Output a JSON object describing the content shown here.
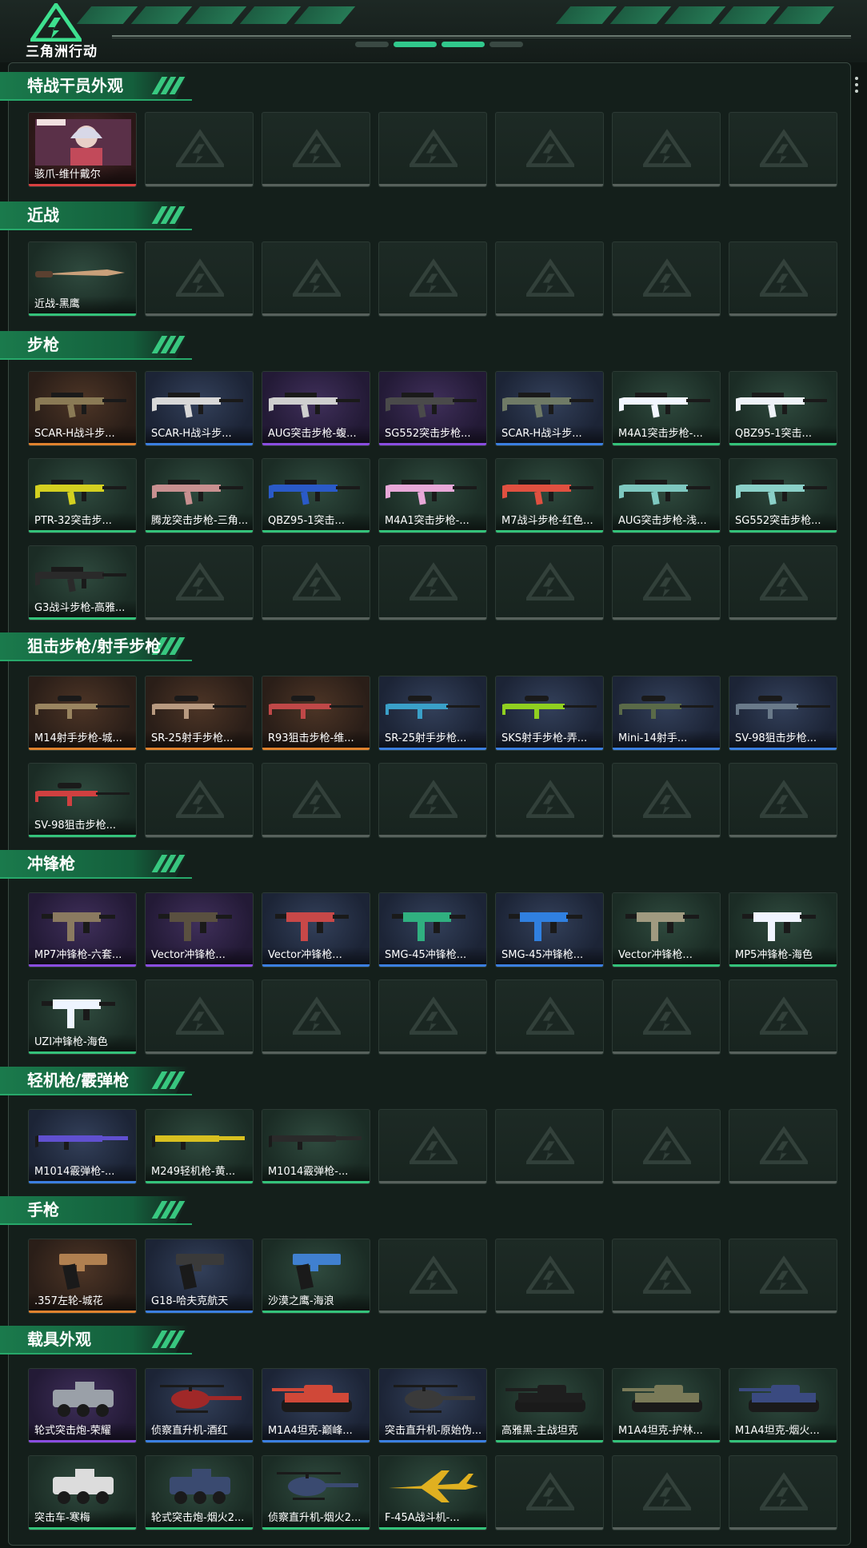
{
  "brand": "三角洲行动",
  "sections": [
    {
      "title": "特战干员外观",
      "items": [
        {
          "label": "骇爪-维什戴尔",
          "quality": "red",
          "icon": "operator-portrait-icon",
          "color": "#c24a5a"
        }
      ]
    },
    {
      "title": "近战",
      "items": [
        {
          "label": "近战-黑鹰",
          "quality": "green",
          "icon": "knife-icon",
          "color": "#c9a07a"
        }
      ]
    },
    {
      "title": "步枪",
      "items": [
        {
          "label": "SCAR-H战斗步...",
          "quality": "orange",
          "icon": "rifle-icon",
          "color": "#8a7a55"
        },
        {
          "label": "SCAR-H战斗步...",
          "quality": "blue",
          "icon": "rifle-icon",
          "color": "#d8d8d8"
        },
        {
          "label": "AUG突击步枪-蝮...",
          "quality": "purple",
          "icon": "rifle-icon",
          "color": "#cfcfcf"
        },
        {
          "label": "SG552突击步枪...",
          "quality": "purple",
          "icon": "rifle-icon",
          "color": "#4a4a4a"
        },
        {
          "label": "SCAR-H战斗步...",
          "quality": "blue",
          "icon": "rifle-icon",
          "color": "#6f7a66"
        },
        {
          "label": "M4A1突击步枪-...",
          "quality": "green",
          "icon": "rifle-icon",
          "color": "#f2f6ff"
        },
        {
          "label": "QBZ95-1突击...",
          "quality": "green",
          "icon": "rifle-icon",
          "color": "#eef2f8"
        },
        {
          "label": "PTR-32突击步...",
          "quality": "green",
          "icon": "rifle-icon",
          "color": "#d4d020"
        },
        {
          "label": "腾龙突击步枪-三角...",
          "quality": "green",
          "icon": "rifle-icon",
          "color": "#c89090"
        },
        {
          "label": "QBZ95-1突击...",
          "quality": "green",
          "icon": "rifle-icon",
          "color": "#2a5ac8"
        },
        {
          "label": "M4A1突击步枪-...",
          "quality": "green",
          "icon": "rifle-icon",
          "color": "#e8a8d8"
        },
        {
          "label": "M7战斗步枪-红色...",
          "quality": "green",
          "icon": "rifle-icon",
          "color": "#e05040"
        },
        {
          "label": "AUG突击步枪-浅...",
          "quality": "green",
          "icon": "rifle-icon",
          "color": "#7ec8c0"
        },
        {
          "label": "SG552突击步枪...",
          "quality": "green",
          "icon": "rifle-icon",
          "color": "#8ad0c8"
        },
        {
          "label": "G3战斗步枪-高雅...",
          "quality": "green",
          "icon": "rifle-icon",
          "color": "#2a2a2a"
        }
      ]
    },
    {
      "title": "狙击步枪/射手步枪",
      "items": [
        {
          "label": "M14射手步枪-城...",
          "quality": "orange",
          "icon": "sniper-icon",
          "color": "#9a8560"
        },
        {
          "label": "SR-25射手步枪...",
          "quality": "orange",
          "icon": "sniper-icon",
          "color": "#b89a80"
        },
        {
          "label": "R93狙击步枪-维...",
          "quality": "orange",
          "icon": "sniper-icon",
          "color": "#c04848"
        },
        {
          "label": "SR-25射手步枪...",
          "quality": "blue",
          "icon": "sniper-icon",
          "color": "#3aa0c8"
        },
        {
          "label": "SKS射手步枪-弄...",
          "quality": "blue",
          "icon": "sniper-icon",
          "color": "#90d020"
        },
        {
          "label": "Mini-14射手...",
          "quality": "blue",
          "icon": "sniper-icon",
          "color": "#5a6a48"
        },
        {
          "label": "SV-98狙击步枪...",
          "quality": "blue",
          "icon": "sniper-icon",
          "color": "#6a7a8a"
        },
        {
          "label": "SV-98狙击步枪...",
          "quality": "green",
          "icon": "sniper-icon",
          "color": "#d04040"
        }
      ]
    },
    {
      "title": "冲锋枪",
      "items": [
        {
          "label": "MP7冲锋枪-六套...",
          "quality": "purple",
          "icon": "smg-icon",
          "color": "#8a7a60"
        },
        {
          "label": "Vector冲锋枪...",
          "quality": "purple",
          "icon": "smg-icon",
          "color": "#5a5040"
        },
        {
          "label": "Vector冲锋枪...",
          "quality": "blue",
          "icon": "smg-icon",
          "color": "#c84848"
        },
        {
          "label": "SMG-45冲锋枪...",
          "quality": "blue",
          "icon": "smg-icon",
          "color": "#30b080"
        },
        {
          "label": "SMG-45冲锋枪...",
          "quality": "blue",
          "icon": "smg-icon",
          "color": "#3080e0"
        },
        {
          "label": "Vector冲锋枪...",
          "quality": "green",
          "icon": "smg-icon",
          "color": "#a09a80"
        },
        {
          "label": "MP5冲锋枪-海色",
          "quality": "green",
          "icon": "smg-icon",
          "color": "#f0f4ff"
        },
        {
          "label": "UZI冲锋枪-海色",
          "quality": "green",
          "icon": "smg-icon",
          "color": "#eef4ff"
        }
      ]
    },
    {
      "title": "轻机枪/霰弹枪",
      "items": [
        {
          "label": "M1014霰弹枪-...",
          "quality": "blue",
          "icon": "shotgun-icon",
          "color": "#6050d0"
        },
        {
          "label": "M249轻机枪-黄...",
          "quality": "green",
          "icon": "lmg-icon",
          "color": "#d8c020"
        },
        {
          "label": "M1014霰弹枪-...",
          "quality": "green",
          "icon": "shotgun-icon",
          "color": "#2a2a2a"
        }
      ]
    },
    {
      "title": "手枪",
      "items": [
        {
          "label": ".357左轮-城花",
          "quality": "orange",
          "icon": "revolver-icon",
          "color": "#b08050"
        },
        {
          "label": "G18-哈夫克航天",
          "quality": "blue",
          "icon": "pistol-icon",
          "color": "#3a3a3a"
        },
        {
          "label": "沙漠之鹰-海浪",
          "quality": "green",
          "icon": "pistol-icon",
          "color": "#4080d0"
        }
      ]
    },
    {
      "title": "载具外观",
      "items": [
        {
          "label": "轮式突击炮-荣耀",
          "quality": "purple",
          "icon": "armored-car-icon",
          "color": "#9aa0a8"
        },
        {
          "label": "侦察直升机-酒红",
          "quality": "blue",
          "icon": "helicopter-icon",
          "color": "#a02828"
        },
        {
          "label": "M1A4坦克-巅峰...",
          "quality": "blue",
          "icon": "tank-icon",
          "color": "#d04838"
        },
        {
          "label": "突击直升机-原始伪...",
          "quality": "blue",
          "icon": "helicopter-icon",
          "color": "#3a3a3a"
        },
        {
          "label": "高雅黑-主战坦克",
          "quality": "green",
          "icon": "tank-icon",
          "color": "#1e1e1e"
        },
        {
          "label": "M1A4坦克-护林...",
          "quality": "green",
          "icon": "tank-icon",
          "color": "#7a7a58"
        },
        {
          "label": "M1A4坦克-烟火...",
          "quality": "green",
          "icon": "tank-icon",
          "color": "#3a4a80"
        },
        {
          "label": "突击车-寒梅",
          "quality": "green",
          "icon": "armored-car-icon",
          "color": "#dcdcdc"
        },
        {
          "label": "轮式突击炮-烟火2...",
          "quality": "green",
          "icon": "armored-car-icon",
          "color": "#3a4a70"
        },
        {
          "label": "侦察直升机-烟火2...",
          "quality": "green",
          "icon": "helicopter-icon",
          "color": "#3a4a70"
        },
        {
          "label": "F-45A战斗机-...",
          "quality": "green",
          "icon": "fighter-jet-icon",
          "color": "#e0b020"
        }
      ]
    }
  ]
}
